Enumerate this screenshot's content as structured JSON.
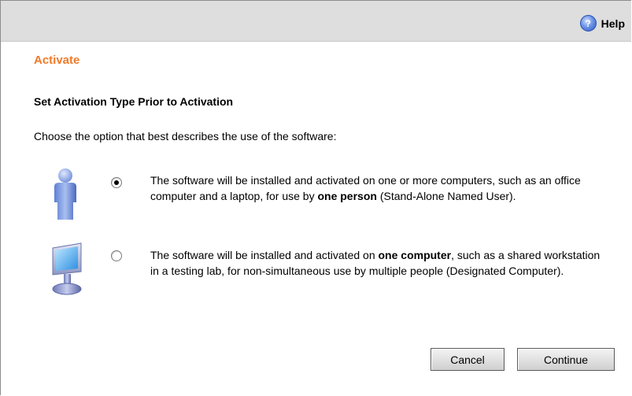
{
  "header": {
    "help_label": "Help",
    "help_icon": "help-icon",
    "help_icon_glyph": "?"
  },
  "page": {
    "title": "Activate",
    "subtitle": "Set Activation Type Prior to Activation",
    "prompt": "Choose the option that best describes the use of the software:"
  },
  "options": [
    {
      "icon": "person-icon",
      "selected": true,
      "text_before": "The software will be installed and activated on one or more computers, such as an office computer and a laptop, for use by ",
      "text_bold": "one person",
      "text_after": " (Stand-Alone Named User)."
    },
    {
      "icon": "computer-icon",
      "selected": false,
      "text_before": "The software will be installed and activated on ",
      "text_bold": "one computer",
      "text_after": ", such as a shared workstation in a testing lab, for non-simultaneous use by multiple people (Designated Computer)."
    }
  ],
  "buttons": {
    "cancel_label": "Cancel",
    "continue_label": "Continue"
  },
  "colors": {
    "title": "#f07a2a",
    "topbar": "#dedede"
  }
}
